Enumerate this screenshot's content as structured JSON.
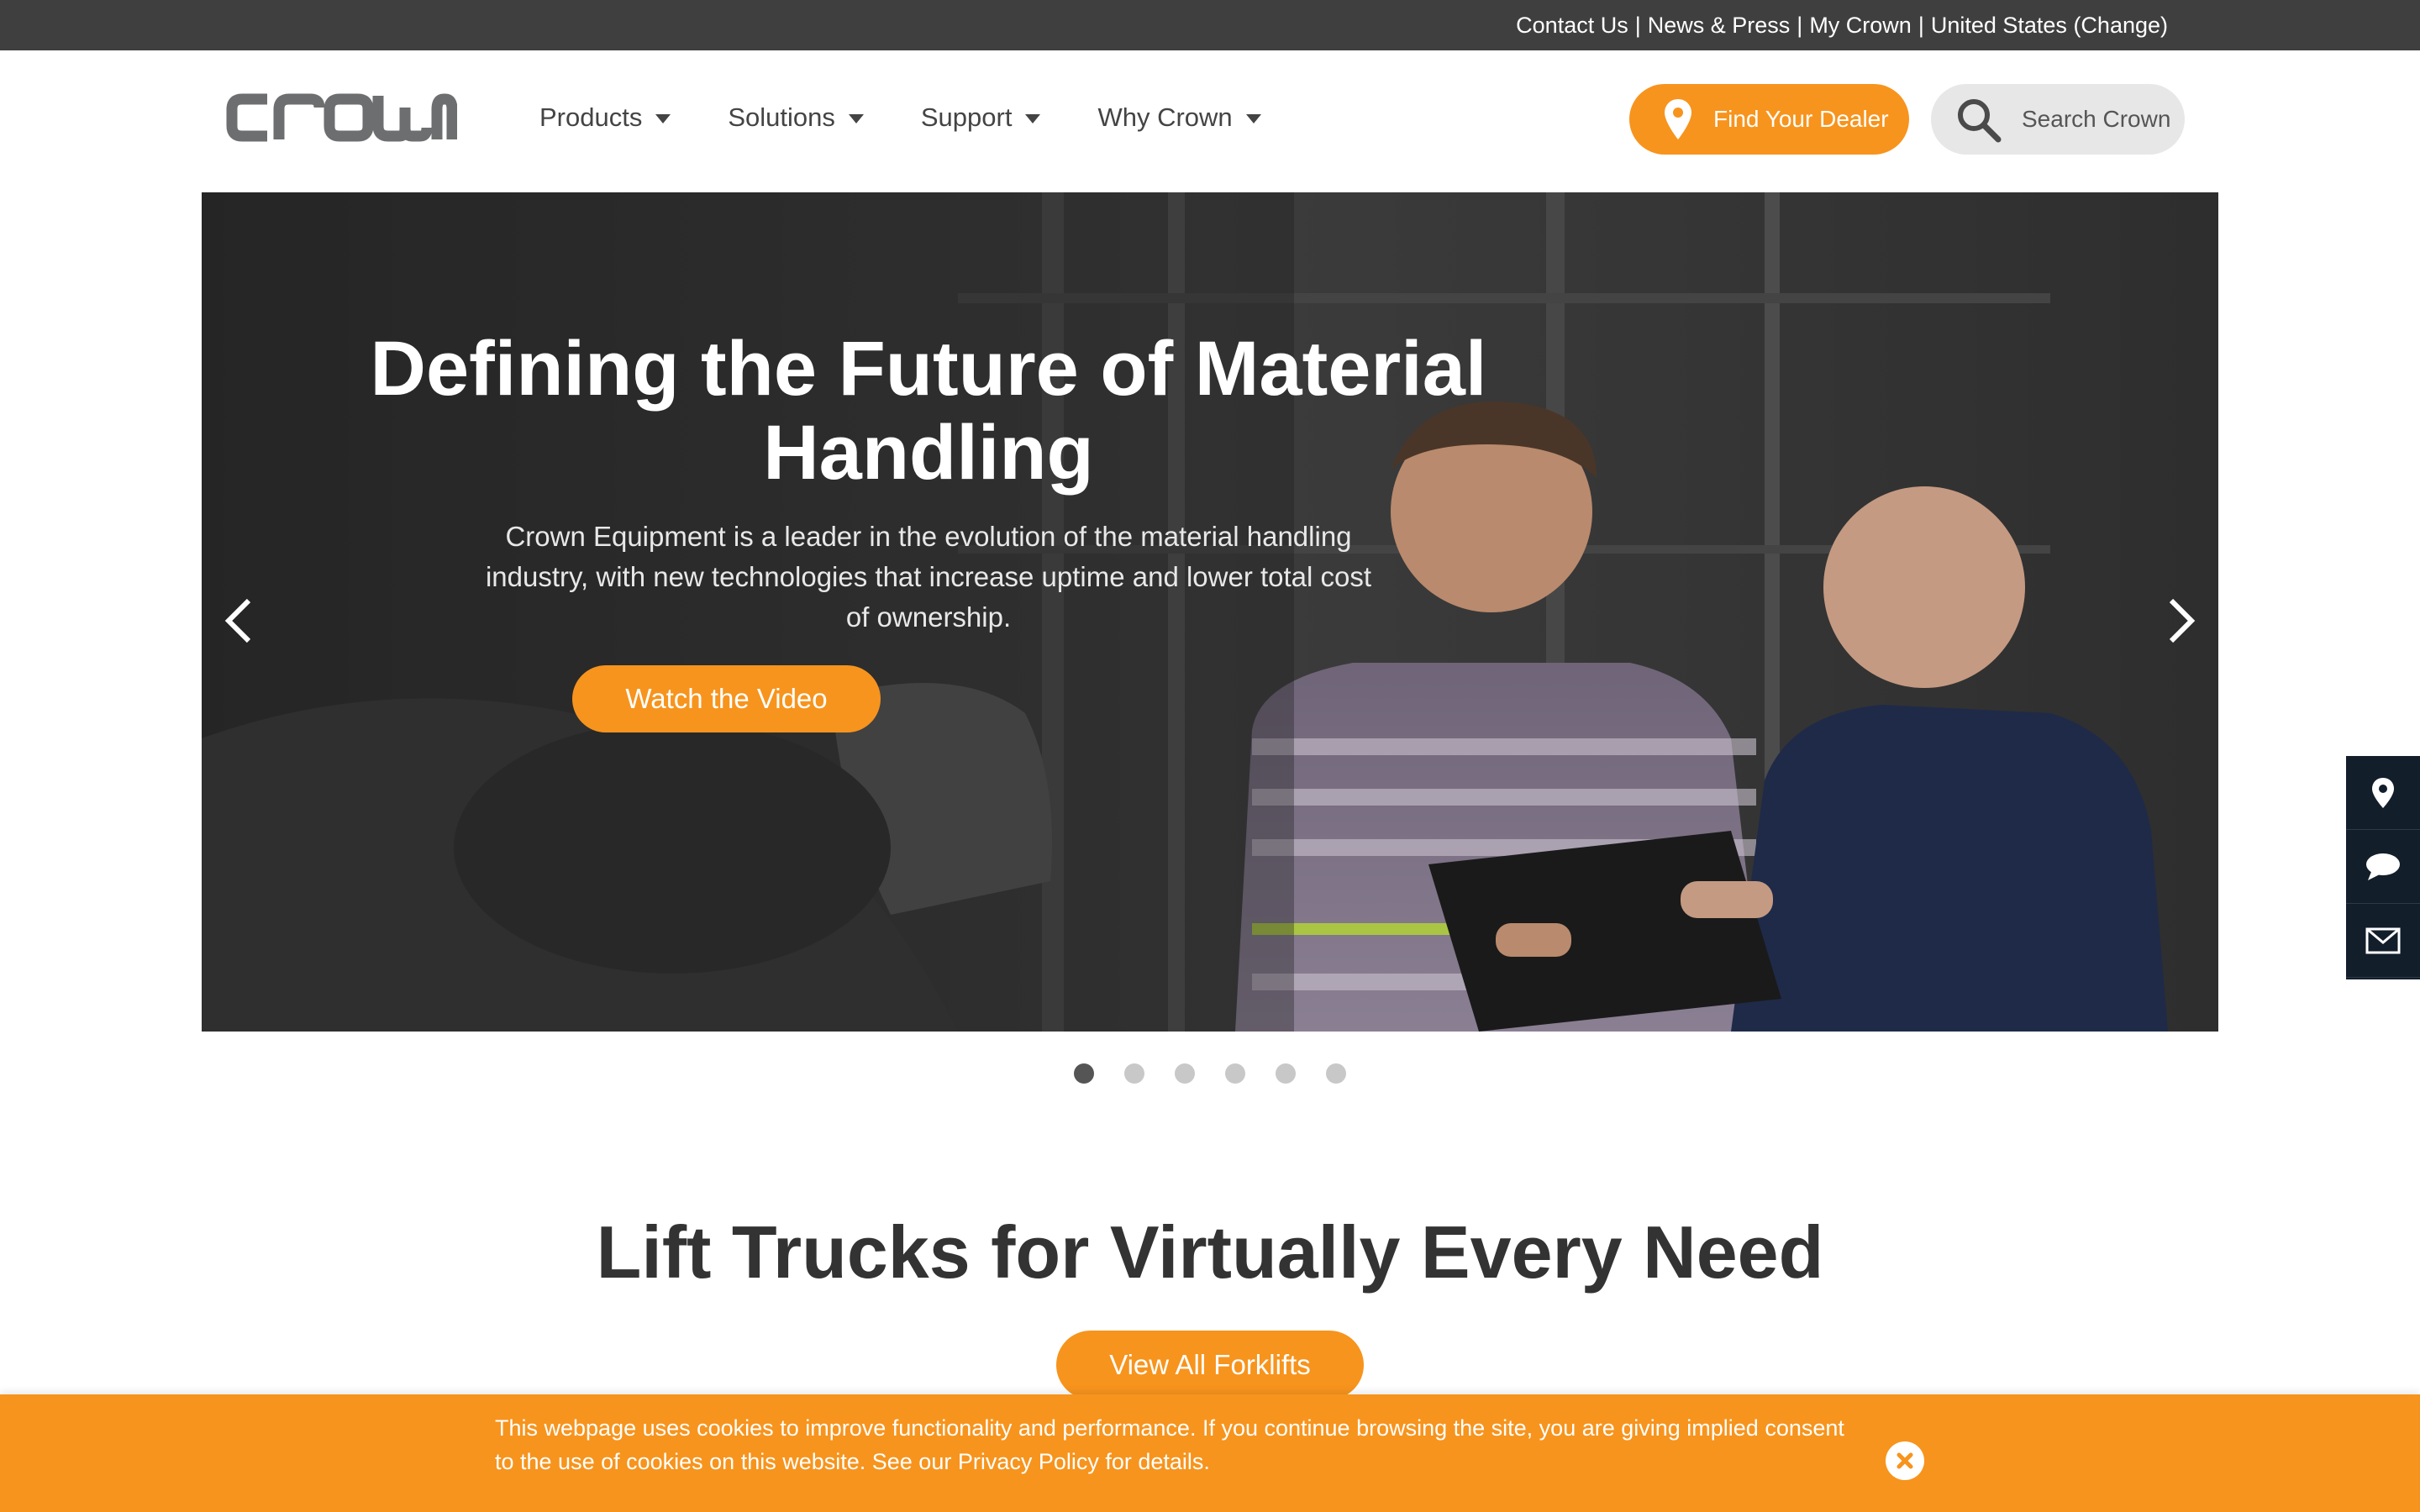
{
  "topbar": {
    "links": [
      "Contact Us",
      "News & Press",
      "My Crown",
      "United States (Change)"
    ],
    "separator": "|"
  },
  "header": {
    "logo_text": "CROWN",
    "nav": [
      "Products",
      "Solutions",
      "Support",
      "Why Crown"
    ],
    "dealer_label": "Find Your Dealer",
    "search_label": "Search Crown"
  },
  "hero": {
    "title": "Defining the Future of Material Handling",
    "body": "Crown Equipment is a leader in the evolution of the material handling industry, with new technologies that increase uptime and lower total cost of ownership.",
    "button": "Watch the Video",
    "slides_total": 6,
    "active_slide": 1
  },
  "side_tools": [
    "location-pin-icon",
    "chat-bubble-icon",
    "envelope-icon"
  ],
  "section": {
    "title": "Lift Trucks for Virtually Every Need",
    "button": "View All Forklifts"
  },
  "cookie": {
    "text": "This webpage uses cookies to improve functionality and performance. If you continue browsing the site, you are giving implied consent to the use of cookies on this website. See our Privacy Policy for details."
  },
  "colors": {
    "accent": "#f7941d",
    "topbar": "#3f3f3f",
    "sidetools": "#131e2b"
  }
}
